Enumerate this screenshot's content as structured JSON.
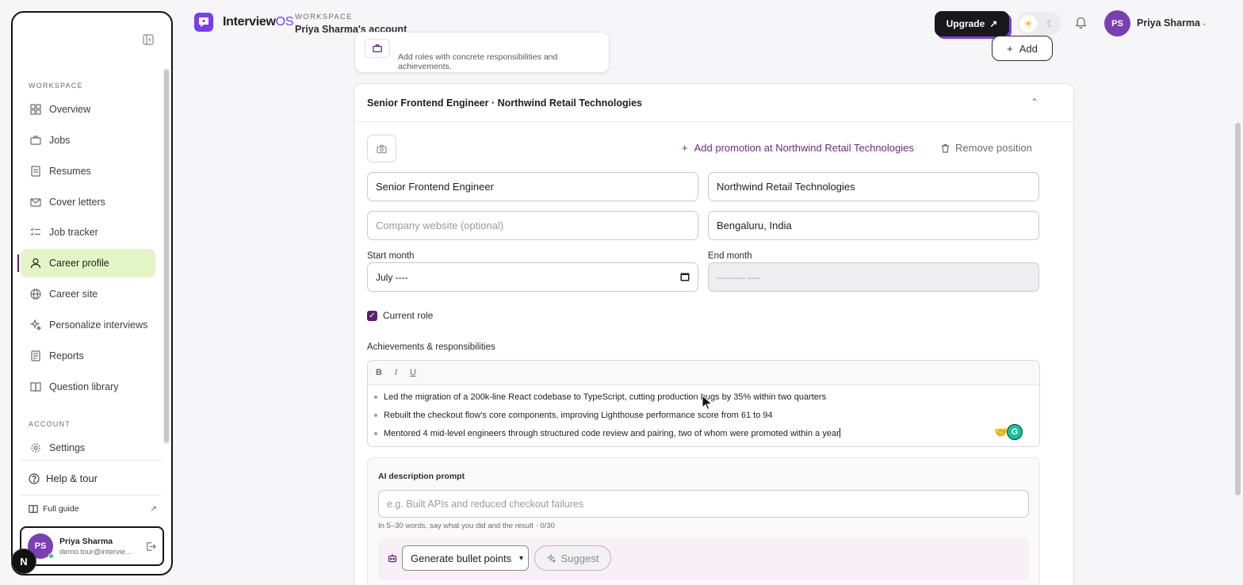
{
  "sidebar": {
    "workspace_section": "WORKSPACE",
    "account_section": "ACCOUNT",
    "items": [
      {
        "label": "Overview",
        "icon": "grid-icon"
      },
      {
        "label": "Jobs",
        "icon": "briefcase-icon"
      },
      {
        "label": "Resumes",
        "icon": "document-icon"
      },
      {
        "label": "Cover letters",
        "icon": "mail-icon"
      },
      {
        "label": "Job tracker",
        "icon": "checklist-icon"
      },
      {
        "label": "Career profile",
        "icon": "user-icon",
        "active": true
      },
      {
        "label": "Career site",
        "icon": "globe-icon"
      },
      {
        "label": "Personalize interviews",
        "icon": "sparkle-icon"
      },
      {
        "label": "Reports",
        "icon": "report-icon"
      },
      {
        "label": "Question library",
        "icon": "book-icon"
      }
    ],
    "settings_label": "Settings",
    "help_label": "Help & tour",
    "guide_label": "Full guide",
    "user": {
      "initials": "PS",
      "name": "Priya Sharma",
      "email": "demo.tour@intervie..."
    }
  },
  "header": {
    "brand_main": "Interview",
    "brand_accent": "OS",
    "workspace_label": "WORKSPACE",
    "workspace_name": "Priya Sharma's account",
    "upgrade_label": "Upgrade",
    "user_initials": "PS",
    "user_name": "Priya Sharma"
  },
  "section": {
    "hint": "Add roles with concrete responsibilities and achievements.",
    "add_label": "Add"
  },
  "position": {
    "title": "Senior Frontend Engineer · Northwind Retail Technologies",
    "add_promotion": "Add promotion at Northwind Retail Technologies",
    "remove": "Remove position",
    "job_title": "Senior Frontend Engineer",
    "company": "Northwind Retail Technologies",
    "website_placeholder": "Company website (optional)",
    "location": "Bengaluru, India",
    "start_label": "Start month",
    "start_value": "July ----",
    "end_label": "End month",
    "end_value": "--------- ----",
    "current_role_label": "Current role",
    "current_role_checked": true,
    "achievements_label": "Achievements & responsibilities",
    "bullets": [
      "Led the migration of a 200k-line React codebase to TypeScript, cutting production bugs by 35% within two quarters",
      "Rebuilt the checkout flow's core components, improving Lighthouse performance score from 61 to 94",
      "Mentored 4 mid-level engineers through structured code review and pairing, two of whom were promoted within a year"
    ]
  },
  "ai": {
    "label": "AI description prompt",
    "placeholder": "e.g. Built APIs and reduced checkout failures",
    "hint": "In 5–30 words, say what you did and the result · 0/30",
    "mode": "Generate bullet points",
    "suggest_label": "Suggest"
  },
  "colors": {
    "accent": "#7a3df0",
    "active_bg": "#e3f5c6",
    "brand_plum": "#5a1e6b"
  }
}
